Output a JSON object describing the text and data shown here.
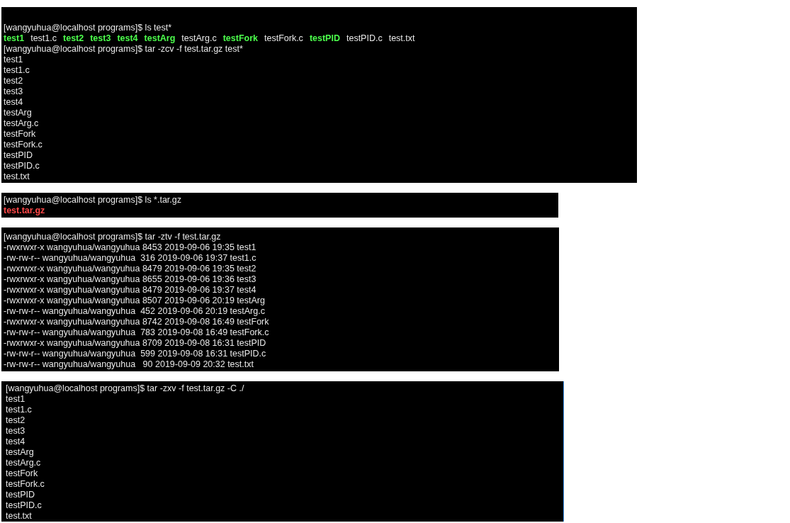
{
  "terminals": [
    {
      "lines": [
        [
          {
            "text": "[wangyuhua@localhost programs]$ ls test*",
            "kind": "plain"
          }
        ],
        [
          {
            "text": "test1",
            "kind": "exec"
          },
          {
            "text": "test1.c",
            "kind": "plain"
          },
          {
            "text": "test2",
            "kind": "exec"
          },
          {
            "text": "test3",
            "kind": "exec"
          },
          {
            "text": "test4",
            "kind": "exec"
          },
          {
            "text": "testArg",
            "kind": "exec"
          },
          {
            "text": "testArg.c",
            "kind": "plain"
          },
          {
            "text": "testFork",
            "kind": "exec"
          },
          {
            "text": "testFork.c",
            "kind": "plain"
          },
          {
            "text": "testPID",
            "kind": "exec"
          },
          {
            "text": "testPID.c",
            "kind": "plain"
          },
          {
            "text": "test.txt",
            "kind": "plain"
          }
        ],
        [
          {
            "text": "[wangyuhua@localhost programs]$ tar -zcv -f test.tar.gz test*",
            "kind": "plain"
          }
        ],
        [
          {
            "text": "test1",
            "kind": "plain"
          }
        ],
        [
          {
            "text": "test1.c",
            "kind": "plain"
          }
        ],
        [
          {
            "text": "test2",
            "kind": "plain"
          }
        ],
        [
          {
            "text": "test3",
            "kind": "plain"
          }
        ],
        [
          {
            "text": "test4",
            "kind": "plain"
          }
        ],
        [
          {
            "text": "testArg",
            "kind": "plain"
          }
        ],
        [
          {
            "text": "testArg.c",
            "kind": "plain"
          }
        ],
        [
          {
            "text": "testFork",
            "kind": "plain"
          }
        ],
        [
          {
            "text": "testFork.c",
            "kind": "plain"
          }
        ],
        [
          {
            "text": "testPID",
            "kind": "plain"
          }
        ],
        [
          {
            "text": "testPID.c",
            "kind": "plain"
          }
        ],
        [
          {
            "text": "test.txt",
            "kind": "plain"
          }
        ]
      ]
    },
    {
      "lines": [
        [
          {
            "text": "[wangyuhua@localhost programs]$ ls *.tar.gz",
            "kind": "plain"
          }
        ],
        [
          {
            "text": "test.tar.gz",
            "kind": "archive"
          }
        ]
      ]
    },
    {
      "lines": [
        [
          {
            "text": "[wangyuhua@localhost programs]$ tar -ztv -f test.tar.gz",
            "kind": "plain"
          }
        ],
        [
          {
            "text": "-rwxrwxr-x wangyuhua/wangyuhua 8453 2019-09-06 19:35 test1",
            "kind": "plain"
          }
        ],
        [
          {
            "text": "-rw-rw-r-- wangyuhua/wangyuhua  316 2019-09-06 19:37 test1.c",
            "kind": "plain"
          }
        ],
        [
          {
            "text": "-rwxrwxr-x wangyuhua/wangyuhua 8479 2019-09-06 19:35 test2",
            "kind": "plain"
          }
        ],
        [
          {
            "text": "-rwxrwxr-x wangyuhua/wangyuhua 8655 2019-09-06 19:36 test3",
            "kind": "plain"
          }
        ],
        [
          {
            "text": "-rwxrwxr-x wangyuhua/wangyuhua 8479 2019-09-06 19:37 test4",
            "kind": "plain"
          }
        ],
        [
          {
            "text": "-rwxrwxr-x wangyuhua/wangyuhua 8507 2019-09-06 20:19 testArg",
            "kind": "plain"
          }
        ],
        [
          {
            "text": "-rw-rw-r-- wangyuhua/wangyuhua  452 2019-09-06 20:19 testArg.c",
            "kind": "plain"
          }
        ],
        [
          {
            "text": "-rwxrwxr-x wangyuhua/wangyuhua 8742 2019-09-08 16:49 testFork",
            "kind": "plain"
          }
        ],
        [
          {
            "text": "-rw-rw-r-- wangyuhua/wangyuhua  783 2019-09-08 16:49 testFork.c",
            "kind": "plain"
          }
        ],
        [
          {
            "text": "-rwxrwxr-x wangyuhua/wangyuhua 8709 2019-09-08 16:31 testPID",
            "kind": "plain"
          }
        ],
        [
          {
            "text": "-rw-rw-r-- wangyuhua/wangyuhua  599 2019-09-08 16:31 testPID.c",
            "kind": "plain"
          }
        ],
        [
          {
            "text": "-rw-rw-r-- wangyuhua/wangyuhua   90 2019-09-09 20:32 test.txt",
            "kind": "plain"
          }
        ]
      ]
    },
    {
      "lines": [
        [
          {
            "text": "[wangyuhua@localhost programs]$ tar -zxv -f test.tar.gz -C ./",
            "kind": "plain"
          }
        ],
        [
          {
            "text": "test1",
            "kind": "plain"
          }
        ],
        [
          {
            "text": "test1.c",
            "kind": "plain"
          }
        ],
        [
          {
            "text": "test2",
            "kind": "plain"
          }
        ],
        [
          {
            "text": "test3",
            "kind": "plain"
          }
        ],
        [
          {
            "text": "test4",
            "kind": "plain"
          }
        ],
        [
          {
            "text": "testArg",
            "kind": "plain"
          }
        ],
        [
          {
            "text": "testArg.c",
            "kind": "plain"
          }
        ],
        [
          {
            "text": "testFork",
            "kind": "plain"
          }
        ],
        [
          {
            "text": "testFork.c",
            "kind": "plain"
          }
        ],
        [
          {
            "text": "testPID",
            "kind": "plain"
          }
        ],
        [
          {
            "text": "testPID.c",
            "kind": "plain"
          }
        ],
        [
          {
            "text": "test.txt",
            "kind": "plain"
          }
        ]
      ]
    }
  ]
}
